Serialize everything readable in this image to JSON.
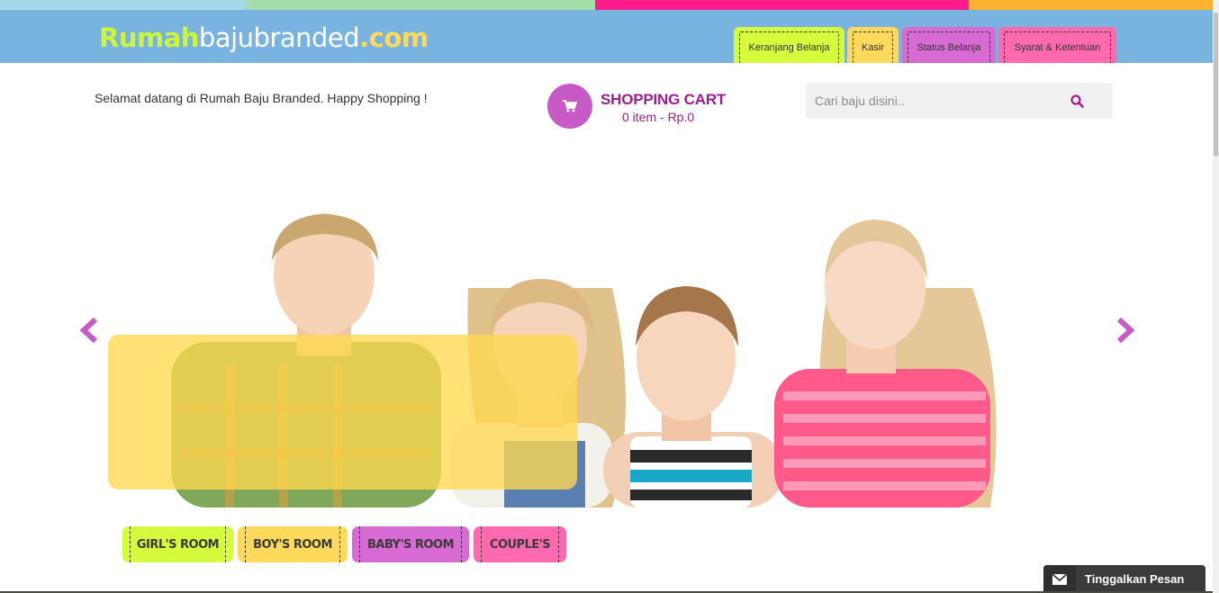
{
  "stripe_colors": [
    "#a5d9e9",
    "#a6ddab",
    "#ff1a8c",
    "#ffb12f"
  ],
  "header": {
    "bg_color": "#79b3e0",
    "logo": {
      "part1": "Rumah",
      "part2": "bajubranded",
      "part3": ".com"
    },
    "tabs": [
      {
        "label": "Keranjang Belanja",
        "color": "#d4fb3c"
      },
      {
        "label": "Kasir",
        "color": "#ffd95c"
      },
      {
        "label": "Status Belanja",
        "color": "#d86ad4"
      },
      {
        "label": "Syarat & Ketentuan",
        "color": "#ff6aaf"
      }
    ]
  },
  "welcome_text": "Selamat datang di Rumah Baju Branded. Happy Shopping !",
  "cart": {
    "icon": "cart-icon",
    "title": "SHOPPING CART",
    "summary": "0 item - Rp.0",
    "accent": "#a11c8e",
    "circle_color": "#c85ac8"
  },
  "search": {
    "placeholder": "Cari baju disini..",
    "value": "",
    "icon": "search-icon"
  },
  "slider": {
    "prev_icon": "chevron-left-icon",
    "next_icon": "chevron-right-icon",
    "arrow_color": "#c85ac8",
    "caption_color": "#ffd850"
  },
  "categories": [
    {
      "label": "GIRL'S ROOM",
      "color": "#d4fb3c"
    },
    {
      "label": "BOY'S ROOM",
      "color": "#ffd95c"
    },
    {
      "label": "BABY'S ROOM",
      "color": "#d86ad4"
    },
    {
      "label": "COUPLE'S",
      "color": "#ff6aaf"
    }
  ],
  "message_widget": {
    "icon": "envelope-icon",
    "label": "Tinggalkan Pesan"
  }
}
